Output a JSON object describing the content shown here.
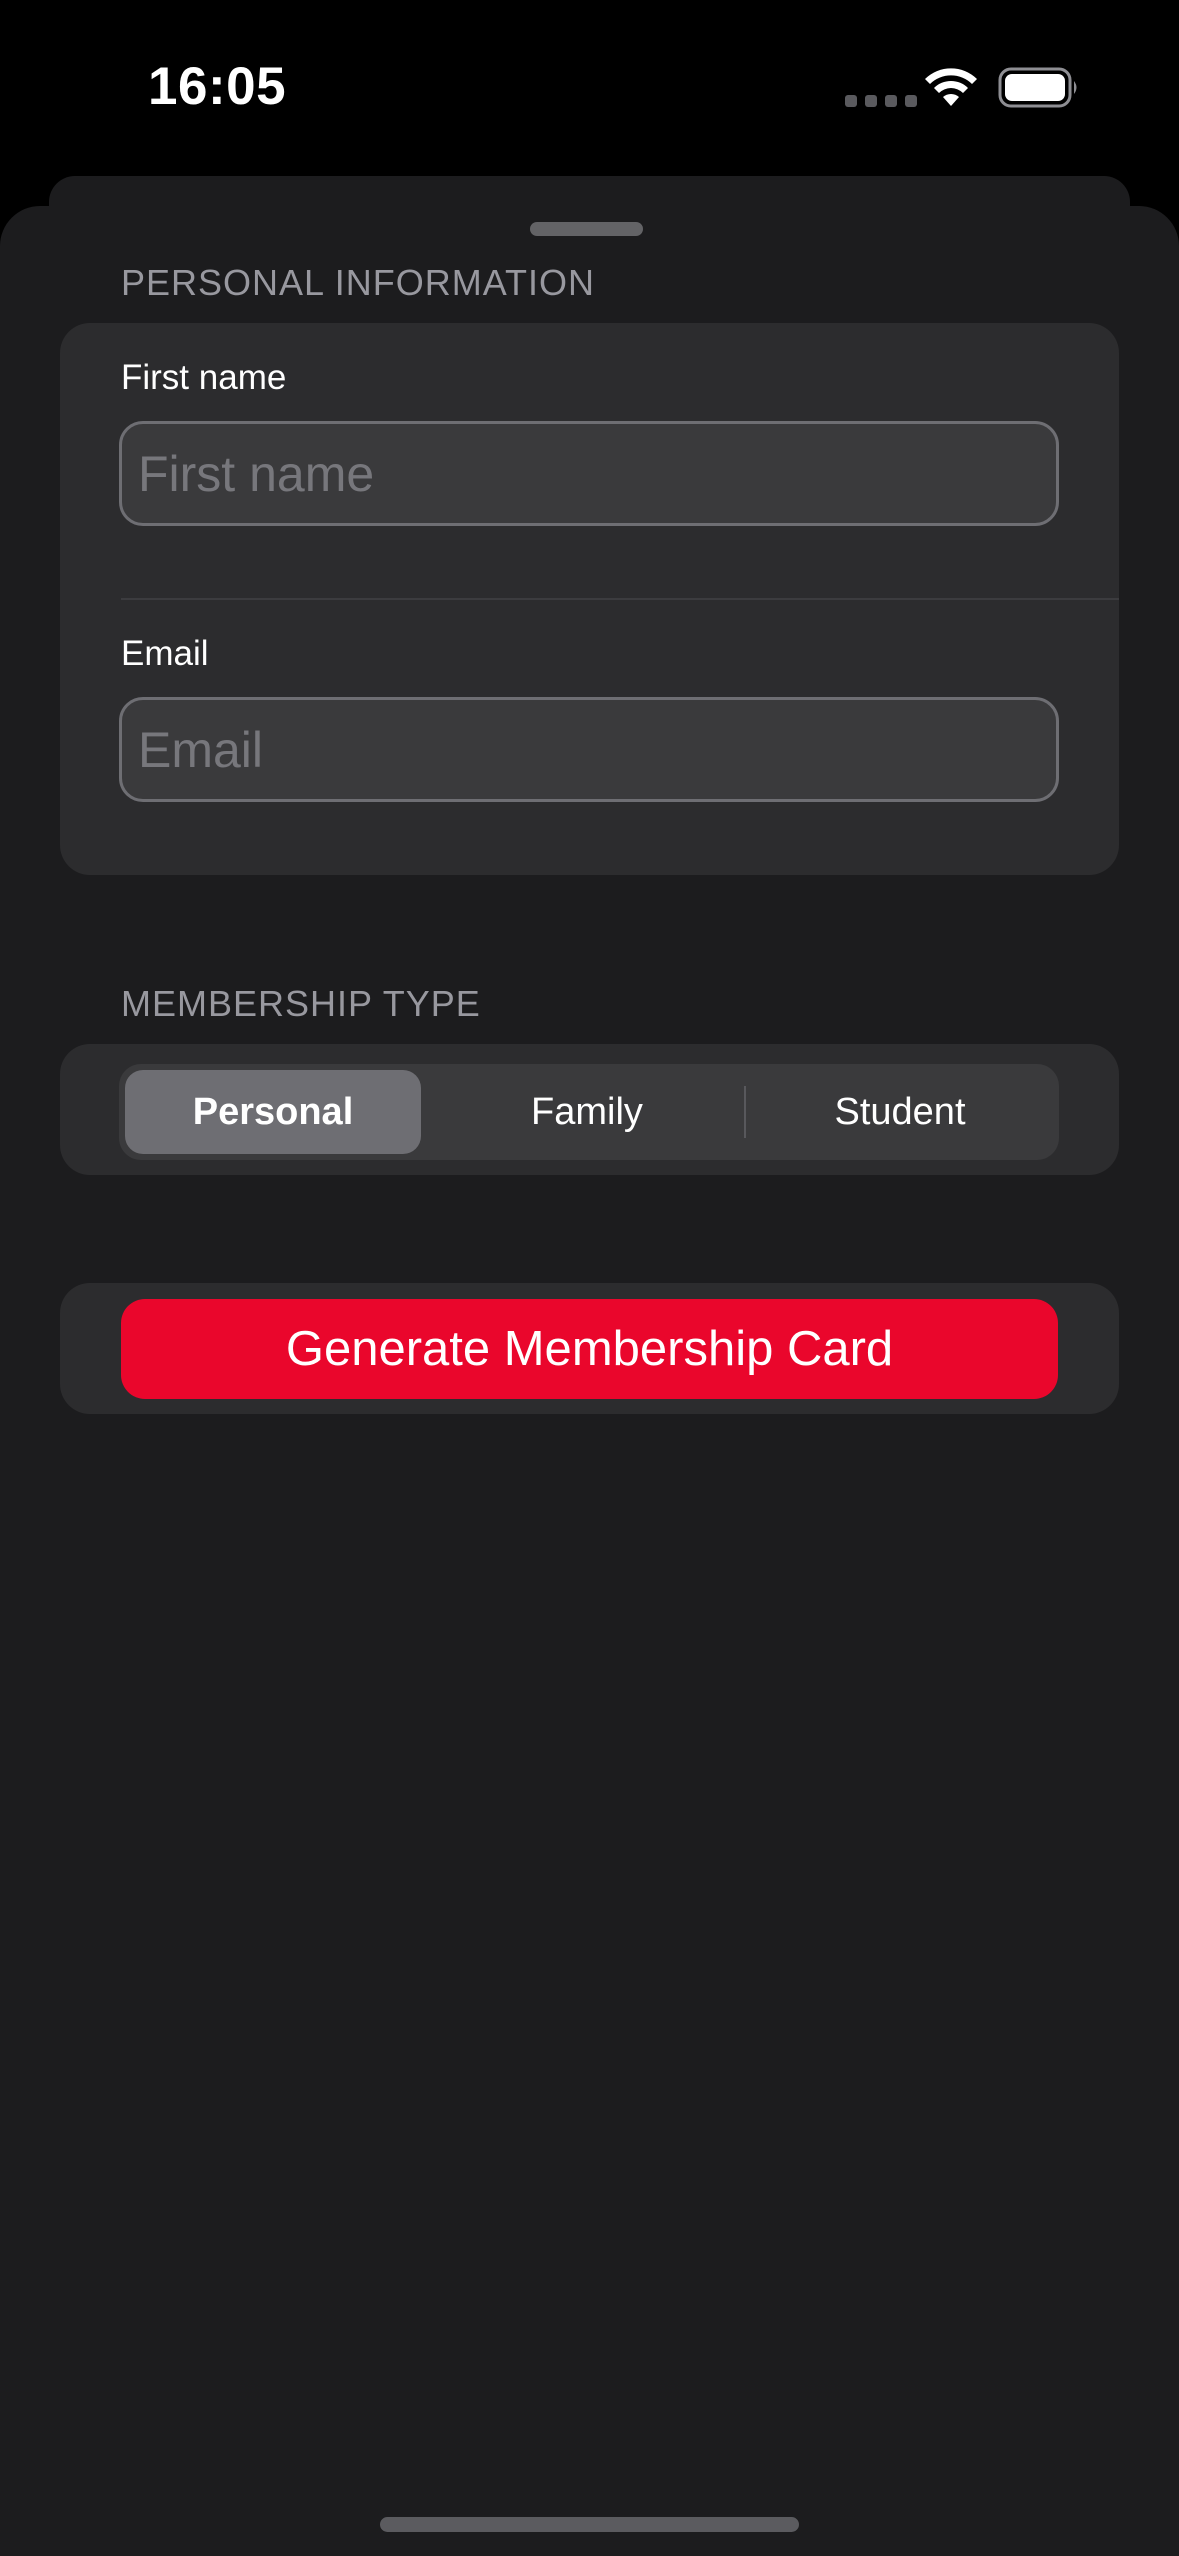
{
  "status_bar": {
    "time": "16:05",
    "icons": [
      "cellular-dots-icon",
      "wifi-icon",
      "battery-icon"
    ]
  },
  "form": {
    "personal_section": {
      "header": "PERSONAL INFORMATION",
      "first_name": {
        "label": "First name",
        "value": "",
        "placeholder": "First name"
      },
      "email": {
        "label": "Email",
        "value": "",
        "placeholder": "Email"
      }
    },
    "membership_section": {
      "header": "MEMBERSHIP TYPE",
      "options": [
        "Personal",
        "Family",
        "Student"
      ],
      "selected": "Personal"
    },
    "submit_label": "Generate Membership Card"
  },
  "colors": {
    "accent": "#ea062c",
    "sheet_bg": "#1c1c1e",
    "group_bg": "#2c2c2e",
    "secondary_text": "#98989f"
  }
}
